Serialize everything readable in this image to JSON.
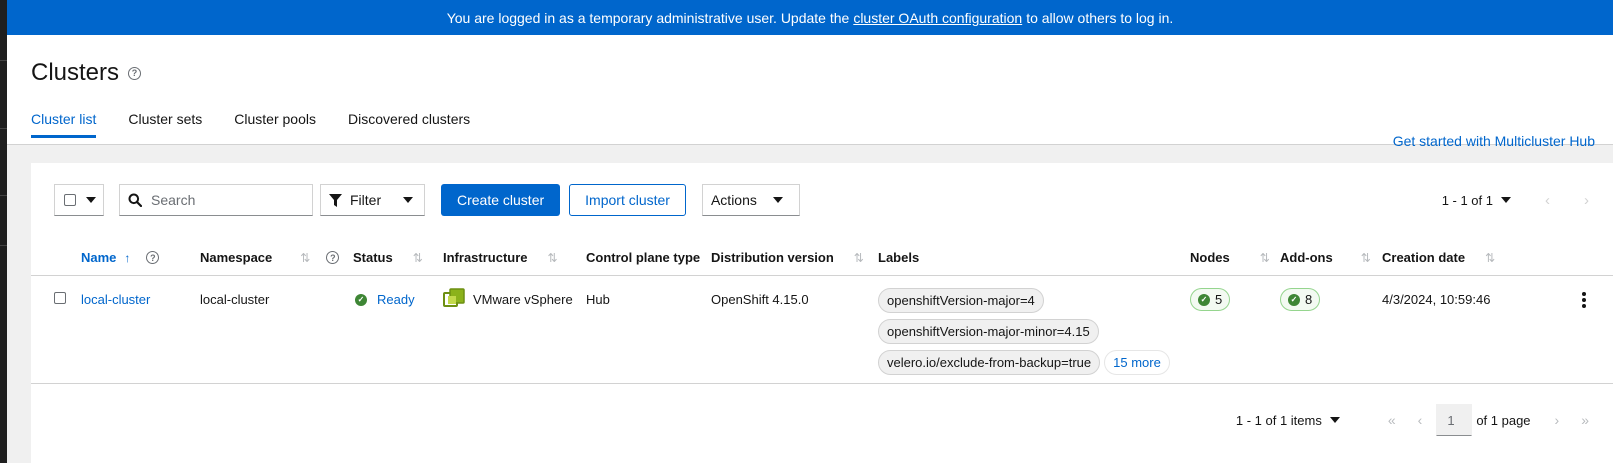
{
  "banner": {
    "text_before": "You are logged in as a temporary administrative user. Update the",
    "link": "cluster OAuth configuration",
    "text_after": "to allow others to log in."
  },
  "page": {
    "title": "Clusters",
    "get_started": "Get started with Multicluster Hub"
  },
  "tabs": [
    {
      "label": "Cluster list",
      "active": true
    },
    {
      "label": "Cluster sets",
      "active": false
    },
    {
      "label": "Cluster pools",
      "active": false
    },
    {
      "label": "Discovered clusters",
      "active": false
    }
  ],
  "toolbar": {
    "search_placeholder": "Search",
    "filter_label": "Filter",
    "create_label": "Create cluster",
    "import_label": "Import cluster",
    "actions_label": "Actions",
    "pagination": "1 - 1 of 1"
  },
  "table": {
    "columns": [
      "Name",
      "Namespace",
      "Status",
      "Infrastructure",
      "Control plane type",
      "Distribution version",
      "Labels",
      "Nodes",
      "Add-ons",
      "Creation date"
    ],
    "rows": [
      {
        "name": "local-cluster",
        "namespace": "local-cluster",
        "status": "Ready",
        "infrastructure": "VMware vSphere",
        "control_plane_type": "Hub",
        "distribution_version": "OpenShift 4.15.0",
        "labels": [
          "openshiftVersion-major=4",
          "openshiftVersion-major-minor=4.15",
          "velero.io/exclude-from-backup=true"
        ],
        "labels_more": "15 more",
        "nodes": "5",
        "addons": "8",
        "creation_date": "4/3/2024, 10:59:46"
      }
    ]
  },
  "footer": {
    "items_count": "1 - 1 of 1 items",
    "page_number": "1",
    "of_pages": "of 1 page"
  },
  "colors": {
    "accent": "#0066cc",
    "success": "#3e8635"
  }
}
